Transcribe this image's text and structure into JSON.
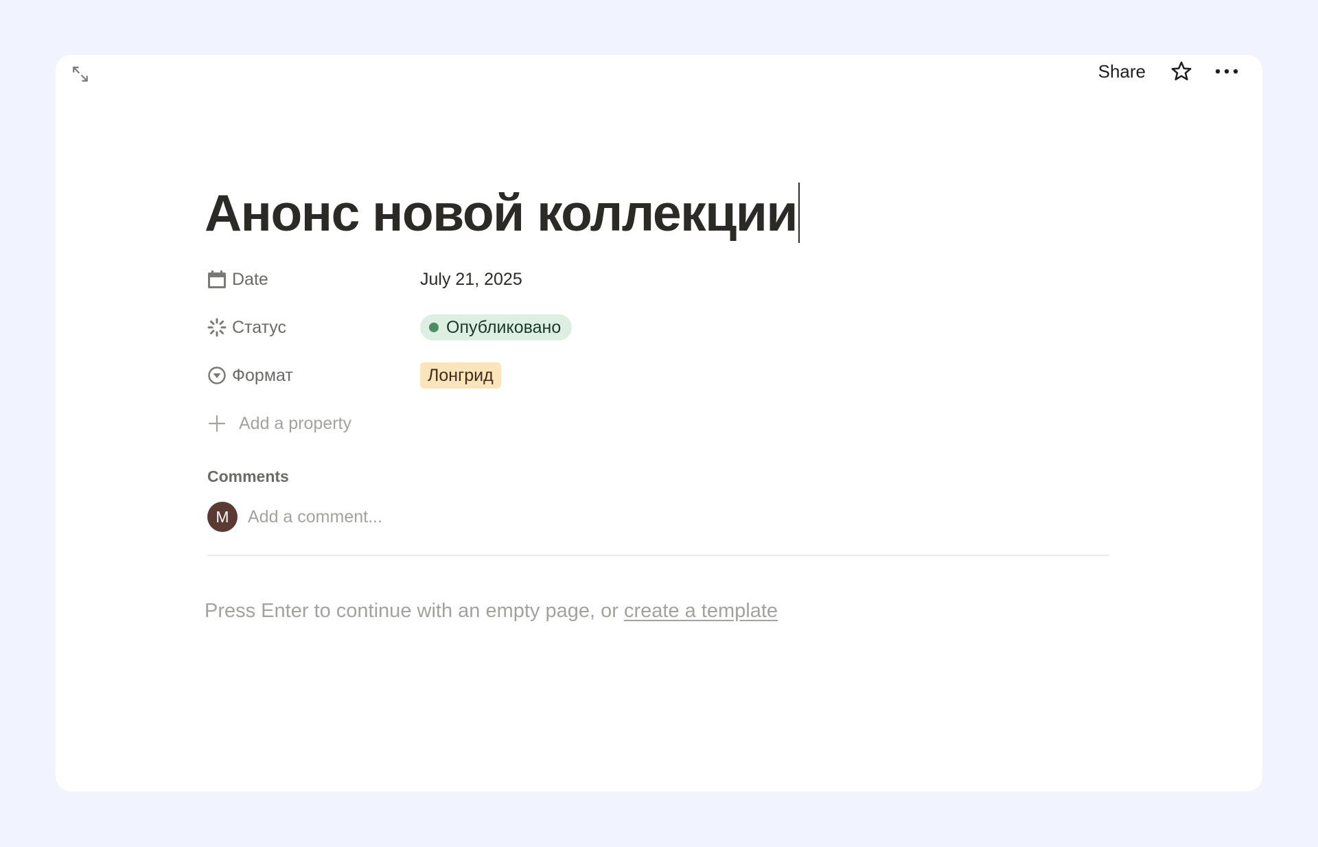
{
  "topbar": {
    "share_label": "Share"
  },
  "icons": {
    "expand": "expand-diagonal-icon",
    "star": "star-outline-icon",
    "more": "more-horizontal-icon",
    "date": "calendar-icon",
    "status": "status-spinner-icon",
    "format": "select-chevron-circle-icon",
    "add": "plus-icon"
  },
  "page": {
    "title": "Анонс новой коллекции"
  },
  "properties": [
    {
      "name": "Date",
      "value": "July 21, 2025"
    },
    {
      "name": "Статус",
      "value": "Опубликовано"
    },
    {
      "name": "Формат",
      "value": "Лонгрид"
    }
  ],
  "add_property_label": "Add a property",
  "comments": {
    "heading": "Comments",
    "avatar_initial": "M",
    "placeholder": "Add a comment..."
  },
  "empty_page": {
    "hint": "Press Enter to continue with an empty page, or ",
    "link": "create a template"
  },
  "colors": {
    "background": "#f1f3ff",
    "status_pill": "#dcefe2",
    "status_dot": "#4a8c63",
    "format_tag": "#fbe4b9",
    "avatar": "#5b3a33"
  }
}
